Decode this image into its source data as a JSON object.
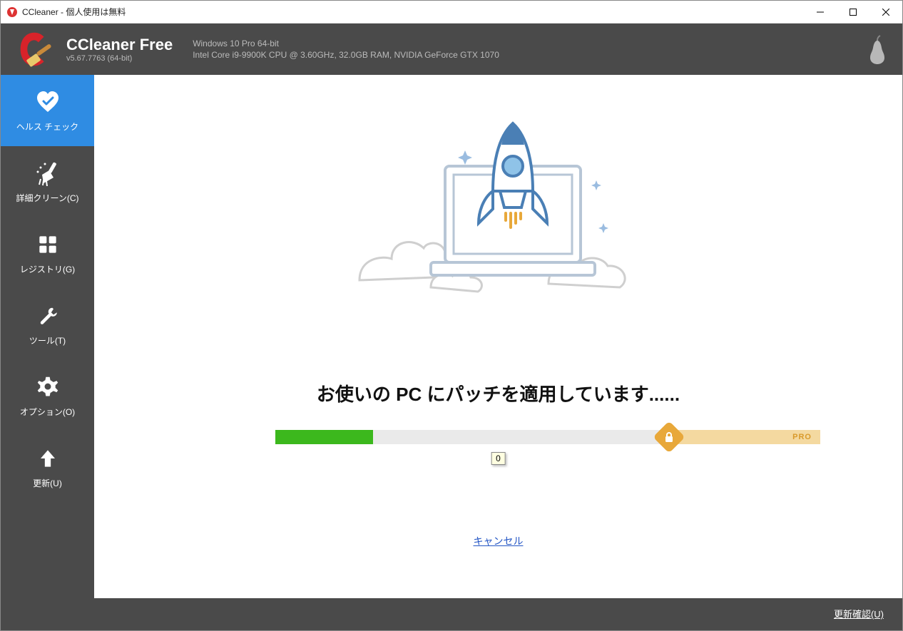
{
  "window": {
    "title": "CCleaner - 個人使用は無料"
  },
  "header": {
    "product": "CCleaner Free",
    "version": "v5.67.7763 (64-bit)",
    "sys_line1": "Windows 10 Pro 64-bit",
    "sys_line2": "Intel Core i9-9900K CPU @ 3.60GHz, 32.0GB RAM, NVIDIA GeForce GTX 1070"
  },
  "sidebar": {
    "items": [
      {
        "label": "ヘルス チェック",
        "icon": "heart-check-icon",
        "active": true
      },
      {
        "label": "詳細クリーン(C)",
        "icon": "brush-icon",
        "active": false
      },
      {
        "label": "レジストリ(G)",
        "icon": "grid-icon",
        "active": false
      },
      {
        "label": "ツール(T)",
        "icon": "wrench-icon",
        "active": false
      },
      {
        "label": "オプション(O)",
        "icon": "gear-icon",
        "active": false
      },
      {
        "label": "更新(U)",
        "icon": "arrow-up-icon",
        "active": false
      }
    ]
  },
  "main": {
    "heading": "お使いの PC にパッチを適用しています......",
    "progress_percent": 18,
    "pro_segment_percent": 28,
    "pro_label": "PRO",
    "tooltip_value": "0",
    "cancel_label": "キャンセル",
    "check_updates_label": "更新確認(U)"
  }
}
